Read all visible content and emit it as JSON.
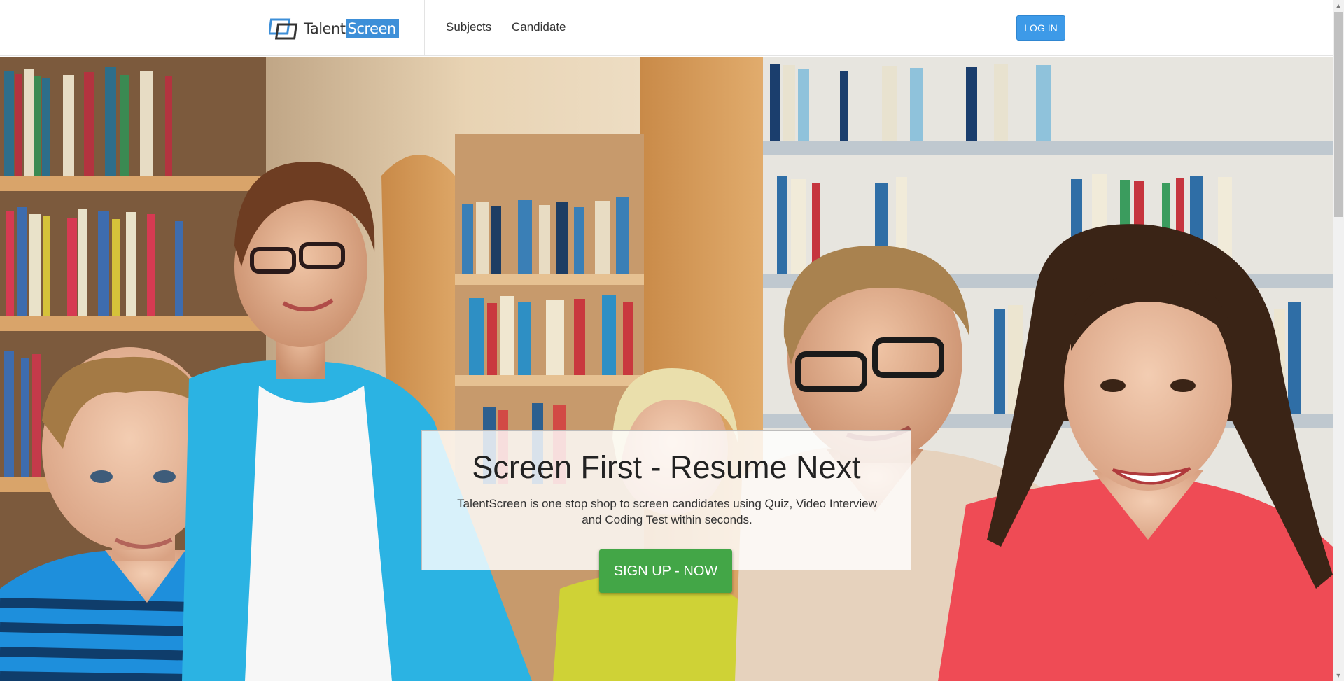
{
  "nav": {
    "brand": {
      "text_a": "Talent",
      "text_b": "Screen"
    },
    "links": [
      "Subjects",
      "Candidate"
    ],
    "login_label": "LOG IN"
  },
  "hero": {
    "headline": "Screen First - Resume Next",
    "subtext": "TalentScreen is one stop shop to screen candidates using Quiz, Video Interview and Coding Test within seconds.",
    "cta_label": "SIGN UP - NOW",
    "image_subject": "group of smiling students in a library"
  },
  "colors": {
    "accent": "#3d9ae8",
    "brand_highlight": "#3d8fd8",
    "cta": "#43a647"
  },
  "icons": {
    "brand_mark": "overlapping-squares-logo",
    "scroll_up": "triangle-up",
    "scroll_down": "triangle-down"
  }
}
